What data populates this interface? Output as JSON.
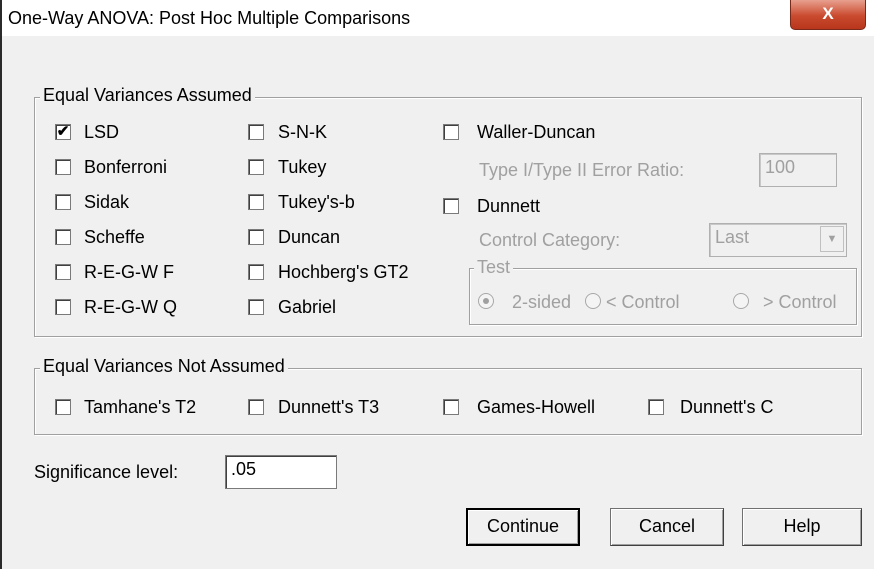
{
  "window": {
    "title": "One-Way ANOVA: Post Hoc Multiple Comparisons",
    "close_label": "X"
  },
  "equal_assumed": {
    "legend": "Equal Variances Assumed",
    "col1": [
      {
        "label": "LSD",
        "checked": true
      },
      {
        "label": "Bonferroni",
        "checked": false
      },
      {
        "label": "Sidak",
        "checked": false
      },
      {
        "label": "Scheffe",
        "checked": false
      },
      {
        "label": "R-E-G-W F",
        "checked": false
      },
      {
        "label": "R-E-G-W Q",
        "checked": false
      }
    ],
    "col2": [
      {
        "label": "S-N-K",
        "checked": false
      },
      {
        "label": "Tukey",
        "checked": false
      },
      {
        "label": "Tukey's-b",
        "checked": false
      },
      {
        "label": "Duncan",
        "checked": false
      },
      {
        "label": "Hochberg's GT2",
        "checked": false
      },
      {
        "label": "Gabriel",
        "checked": false
      }
    ],
    "waller_duncan": {
      "label": "Waller-Duncan",
      "checked": false
    },
    "error_ratio": {
      "label": "Type I/Type II Error Ratio:",
      "value": "100"
    },
    "dunnett": {
      "label": "Dunnett",
      "checked": false
    },
    "control_category": {
      "label": "Control Category:",
      "value": "Last"
    },
    "test": {
      "legend": "Test",
      "options": [
        {
          "label": "2-sided",
          "selected": true
        },
        {
          "label": "< Control",
          "selected": false
        },
        {
          "label": "> Control",
          "selected": false
        }
      ]
    }
  },
  "equal_not_assumed": {
    "legend": "Equal Variances Not Assumed",
    "items": [
      {
        "label": "Tamhane's T2",
        "checked": false
      },
      {
        "label": "Dunnett's T3",
        "checked": false
      },
      {
        "label": "Games-Howell",
        "checked": false
      },
      {
        "label": "Dunnett's C",
        "checked": false
      }
    ]
  },
  "significance": {
    "label": "Significance level:",
    "value": ".05"
  },
  "buttons": {
    "continue": "Continue",
    "cancel": "Cancel",
    "help": "Help"
  },
  "check_mark": "✔"
}
